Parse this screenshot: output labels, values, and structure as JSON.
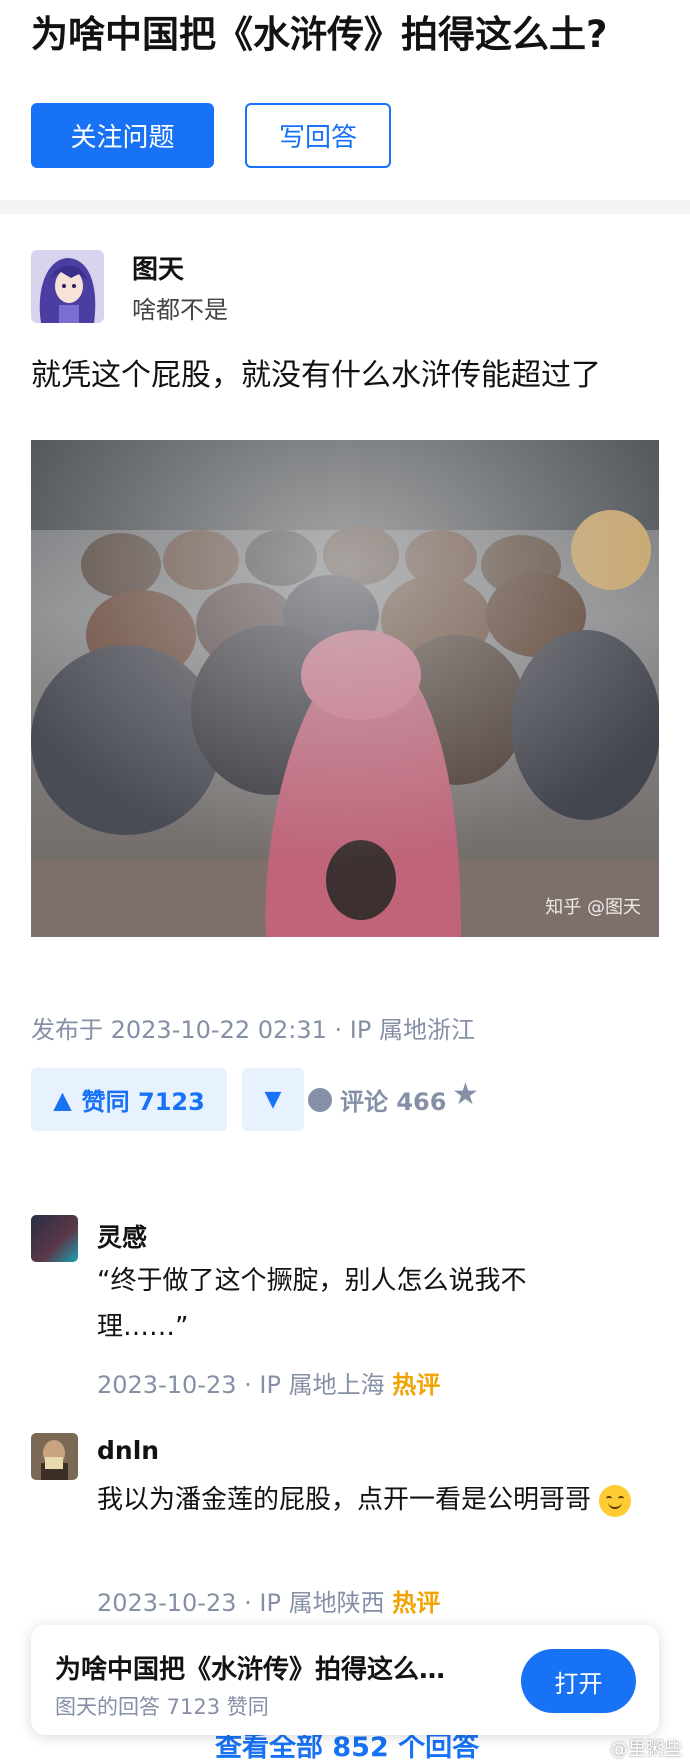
{
  "question": {
    "title": "为啥中国把《水浒传》拍得这么土?",
    "follow_label": "关注问题",
    "write_label": "写回答"
  },
  "answer": {
    "author_name": "图天",
    "author_bio": "啥都不是",
    "text": "就凭这个屁股，就没有什么水浒传能超过了",
    "image_watermark": "知乎 @图天",
    "meta": "发布于 2023-10-22 02:31 · IP 属地浙江",
    "upvote_label": "赞同 7123",
    "comment_label": "评论 466"
  },
  "comments": [
    {
      "name": "灵感",
      "text": "“终于做了这个撅腚，别人怎么说我不理……”",
      "date": "2023-10-23",
      "location": "IP 属地上海",
      "hot": "热评"
    },
    {
      "name": "dnln",
      "text": "我以为潘金莲的屁股，点开一看是公明哥哥",
      "date": "2023-10-23",
      "location": "IP 属地陕西",
      "hot": "热评"
    }
  ],
  "view_all": "查看全部 852 个回答",
  "banner": {
    "title": "为啥中国把《水浒传》拍得这么…",
    "subtitle": "图天的回答 7123 赞同",
    "open_label": "打开"
  },
  "watermark_weibo": "@里粥些",
  "colors": {
    "accent": "#1772f6",
    "hot": "#f1a400",
    "muted": "#8590a6"
  }
}
